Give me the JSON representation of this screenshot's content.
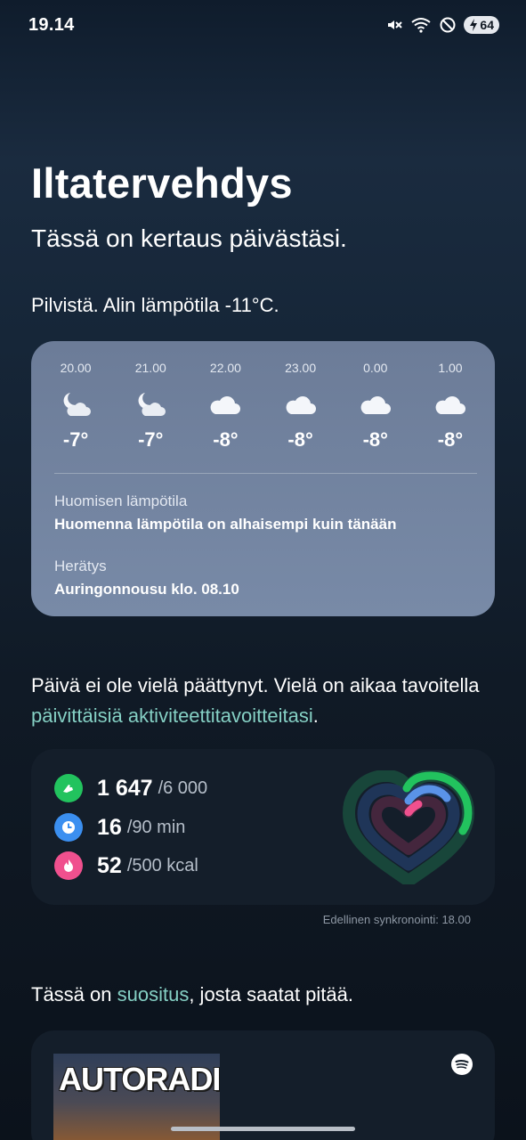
{
  "status_bar": {
    "time": "19.14",
    "battery": "64"
  },
  "greeting": {
    "title": "Iltatervehdys",
    "subtitle": "Tässä on kertaus päivästäsi."
  },
  "weather": {
    "summary": "Pilvistä. Alin lämpötila -11°C.",
    "hours": [
      {
        "time": "20.00",
        "icon": "moon-cloud-icon",
        "temp": "-7°"
      },
      {
        "time": "21.00",
        "icon": "moon-cloud-icon",
        "temp": "-7°"
      },
      {
        "time": "22.00",
        "icon": "cloud-icon",
        "temp": "-8°"
      },
      {
        "time": "23.00",
        "icon": "cloud-icon",
        "temp": "-8°"
      },
      {
        "time": "0.00",
        "icon": "cloud-icon",
        "temp": "-8°"
      },
      {
        "time": "1.00",
        "icon": "cloud-icon",
        "temp": "-8°"
      }
    ],
    "tomorrow_label": "Huomisen lämpötila",
    "tomorrow_value": "Huomenna lämpötila on alhaisempi kuin tänään",
    "wakeup_label": "Herätys",
    "wakeup_value": "Auringonnousu klo. 08.10"
  },
  "activity": {
    "intro_text": "Päivä ei ole vielä päättynyt. Vielä on aikaa tavoitella ",
    "intro_link": "päivittäisiä aktiviteettitavoitteitasi",
    "intro_end": ".",
    "metrics": [
      {
        "name": "steps",
        "value": "1 647",
        "goal": "/6 000",
        "color": "#22c35e",
        "icon": "shoe-icon"
      },
      {
        "name": "active-time",
        "value": "16",
        "goal": "/90 min",
        "color": "#3b8ff0",
        "icon": "clock-icon"
      },
      {
        "name": "calories",
        "value": "52",
        "goal": "/500 kcal",
        "color": "#f0508e",
        "icon": "flame-icon"
      }
    ],
    "last_sync": "Edellinen synkronointi: 18.00"
  },
  "recommendation": {
    "intro_before": "Tässä on ",
    "intro_link": "suositus",
    "intro_after": ", josta saatat pitää.",
    "album_title": "AUTORADIO",
    "service_icon": "spotify-icon"
  }
}
